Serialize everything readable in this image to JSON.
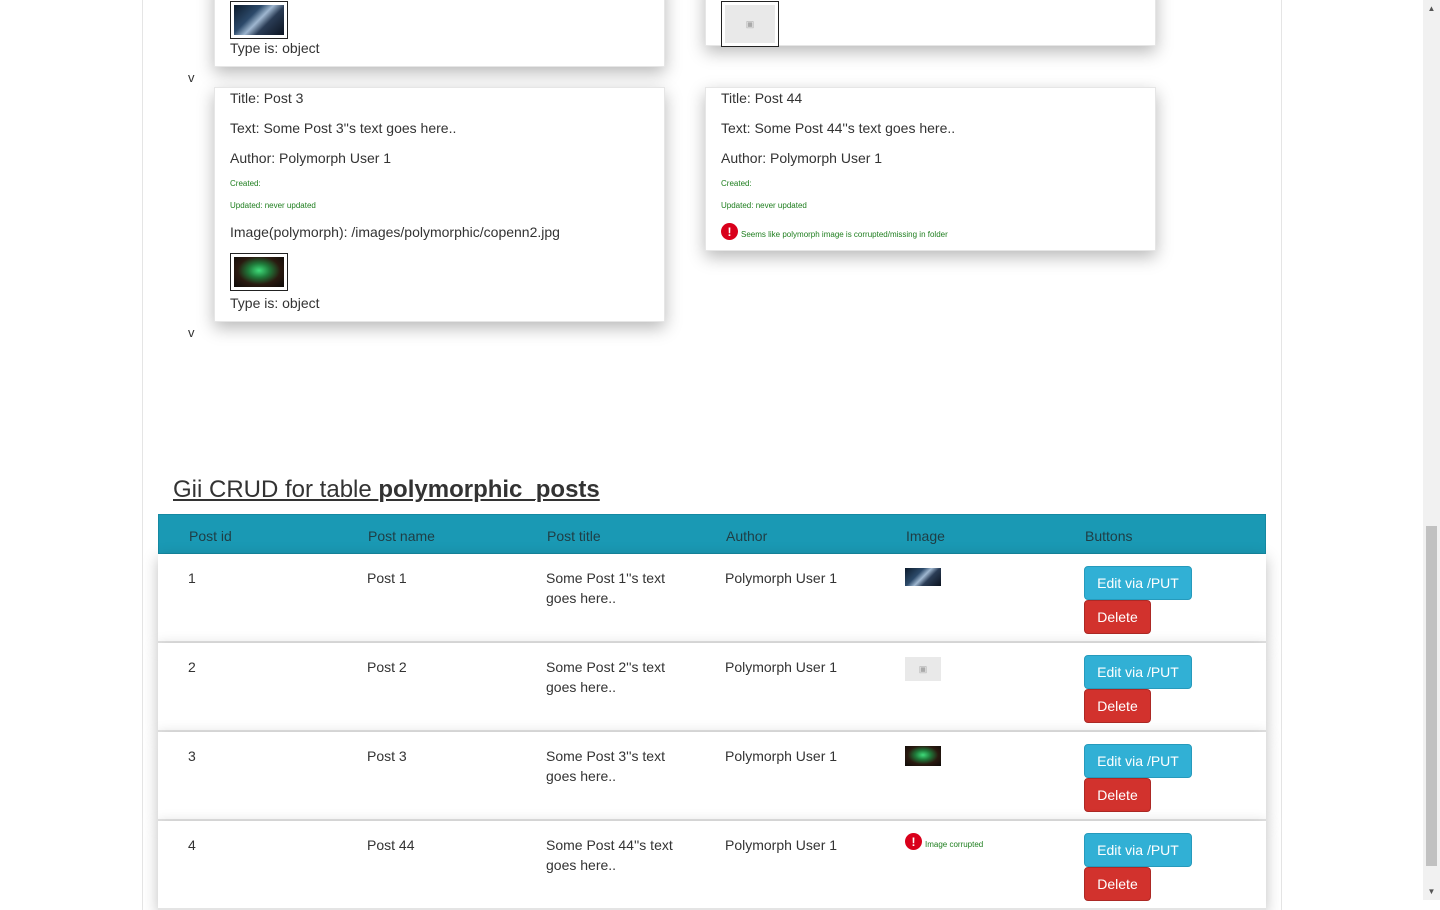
{
  "posts_cards": [
    {
      "type_line": "Type is: object",
      "image": "night1"
    },
    {
      "image": "noimage"
    },
    {
      "title": "Title: Post 3",
      "text": "Text: Some Post 3''s text goes here..",
      "author": "Author: Polymorph User 1",
      "created": "Created:",
      "updated": "Updated: never updated",
      "image_path": "Image(polymorph): /images/polymorphic/copenn2.jpg",
      "type_line": "Type is: object"
    },
    {
      "title": "Title: Post 44",
      "text": "Text: Some Post 44''s text goes here..",
      "author": "Author: Polymorph User 1",
      "created": "Created:",
      "updated": "Updated: never updated",
      "error": "Seems like polymorph image is corrupted/missing in folder"
    }
  ],
  "markers": {
    "v1": "v",
    "v2": "v"
  },
  "heading": {
    "prefix": "Gii CRUD for table ",
    "table_name": "polymorphic_posts"
  },
  "table": {
    "headers": [
      "Post id",
      "Post name",
      "Post title",
      "Author",
      "Image",
      "Buttons"
    ],
    "rows": [
      {
        "id": "1",
        "name": "Post 1",
        "title_line1": "Some Post 1''s text",
        "title_line2": "goes here..",
        "author": "Polymorph User 1",
        "image": "night1"
      },
      {
        "id": "2",
        "name": "Post 2",
        "title_line1": "Some Post 2''s text",
        "title_line2": "goes here..",
        "author": "Polymorph User 1",
        "image": "noimage"
      },
      {
        "id": "3",
        "name": "Post 3",
        "title_line1": "Some Post 3''s text",
        "title_line2": "goes here..",
        "author": "Polymorph User 1",
        "image": "night2"
      },
      {
        "id": "4",
        "name": "Post 44",
        "title_line1": "Some Post 44''s text",
        "title_line2": "goes here..",
        "author": "Polymorph User 1",
        "image": "error",
        "image_error": "Image corrupted"
      }
    ],
    "edit_label": "Edit via /PUT",
    "delete_label": "Delete"
  },
  "colors": {
    "header_bg": "#1a99b4",
    "edit_btn": "#31b0d5",
    "delete_btn": "#d2322d",
    "success_text": "#1e7e1e",
    "error_icon": "#d9001b"
  }
}
